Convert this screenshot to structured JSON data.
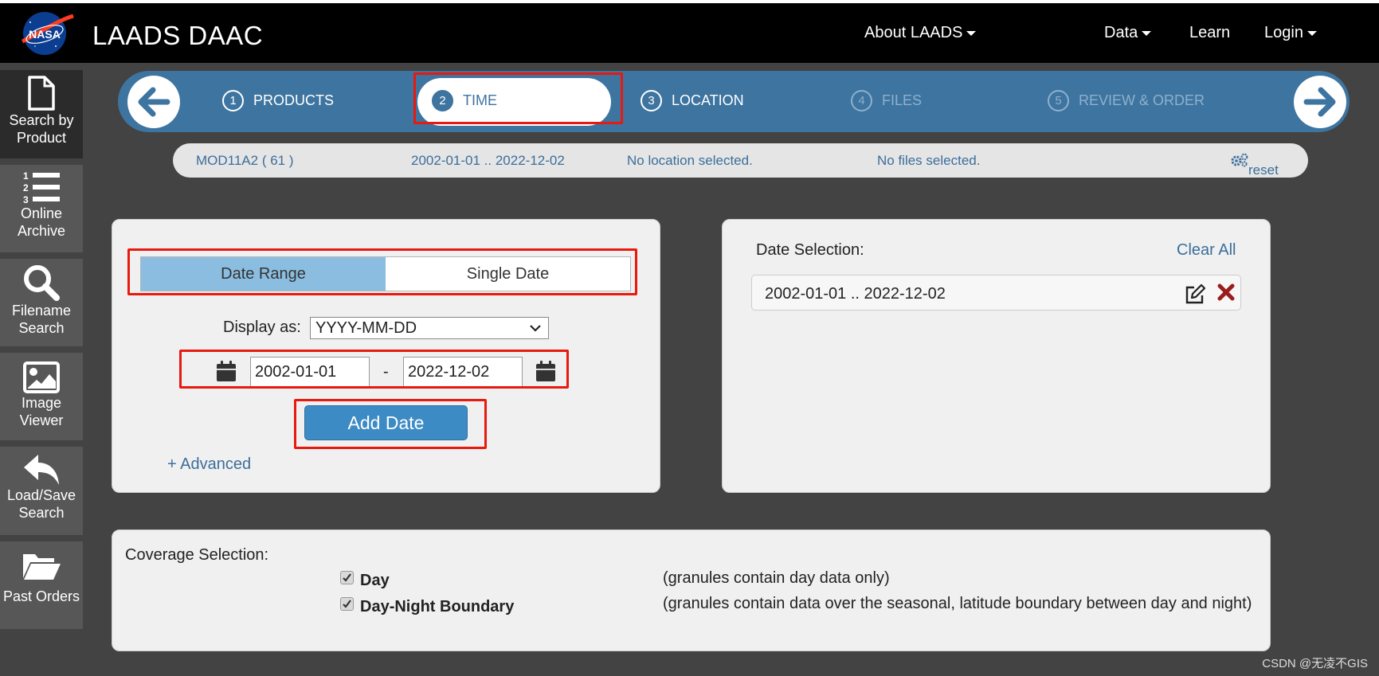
{
  "header": {
    "logo_text": "NASA",
    "title": "LAADS DAAC",
    "nav": [
      "About LAADS",
      "Data",
      "Learn",
      "Login"
    ]
  },
  "sidebar": {
    "items": [
      {
        "label": "Search by Product",
        "icon": "file-icon",
        "active": true
      },
      {
        "label": "Online Archive",
        "icon": "numbered-list-icon",
        "active": false
      },
      {
        "label": "Filename Search",
        "icon": "search-icon",
        "active": false
      },
      {
        "label": "Image Viewer",
        "icon": "image-icon",
        "active": false
      },
      {
        "label": "Load/Save Search",
        "icon": "reply-icon",
        "active": false
      },
      {
        "label": "Past Orders",
        "icon": "folder-open-icon",
        "active": false
      }
    ]
  },
  "stepper": {
    "steps": [
      {
        "num": "1",
        "label": "PRODUCTS",
        "state": "done"
      },
      {
        "num": "2",
        "label": "TIME",
        "state": "active"
      },
      {
        "num": "3",
        "label": "LOCATION",
        "state": "enabled"
      },
      {
        "num": "4",
        "label": "FILES",
        "state": "disabled"
      },
      {
        "num": "5",
        "label": "REVIEW & ORDER",
        "state": "disabled"
      }
    ]
  },
  "summary": {
    "product": "MOD11A2 ( 61 )",
    "dates": "2002-01-01 .. 2022-12-02",
    "location": "No location selected.",
    "files": "No files selected.",
    "reset": "reset"
  },
  "time_panel": {
    "tabs": [
      "Date Range",
      "Single Date"
    ],
    "active_tab": "Date Range",
    "display_label": "Display as:",
    "display_value": "YYYY-MM-DD",
    "start_date": "2002-01-01",
    "separator": "-",
    "end_date": "2022-12-02",
    "add_button": "Add Date",
    "advanced_link": "+ Advanced"
  },
  "date_selection": {
    "title": "Date Selection:",
    "clear_all": "Clear All",
    "entries": [
      "2002-01-01 .. 2022-12-02"
    ]
  },
  "coverage": {
    "title": "Coverage Selection:",
    "options": [
      {
        "label": "Day",
        "checked": true,
        "description": "(granules contain day data only)"
      },
      {
        "label": "Day-Night Boundary",
        "checked": true,
        "description": "(granules contain data over the seasonal, latitude boundary between day and night)"
      }
    ]
  },
  "watermark": "CSDN @无凌不GIS",
  "colors": {
    "header_bg": "#000000",
    "page_bg": "#434343",
    "stepper_bg": "#3d74a0",
    "accent_blue": "#3d8bc4",
    "link_blue": "#3b6e9b",
    "highlight_red": "#e8190f",
    "toggle_active": "#8bbde0",
    "delete_red": "#9b1c1c"
  }
}
